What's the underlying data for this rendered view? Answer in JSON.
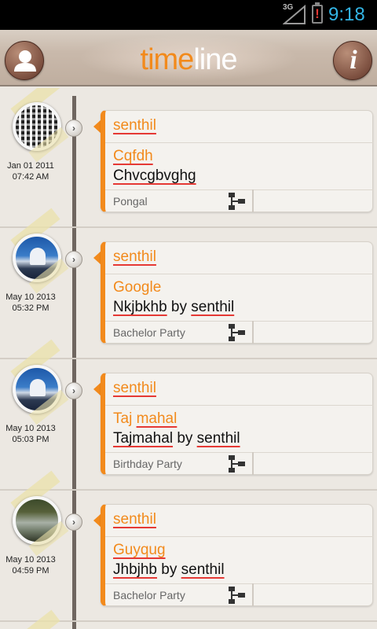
{
  "status_bar": {
    "network": "3G",
    "time": "9:18",
    "colors": {
      "time": "#33b5e5",
      "battery_alert": "#e53935"
    }
  },
  "header": {
    "logo_part1": "time",
    "logo_part2": "line",
    "left_icon": "profile-icon",
    "right_icon": "info-icon",
    "right_icon_glyph": "i",
    "colors": {
      "accent": "#f28a1c"
    }
  },
  "entries": [
    {
      "avatar": "qr-code-image",
      "date": "Jan 01 2011",
      "time": "07:42 AM",
      "user": "senthil",
      "title": "Cqfdh",
      "desc_main": "Chvcgbvghg",
      "desc_by": "",
      "desc_user": "",
      "event": "Pongal"
    },
    {
      "avatar": "taj-mahal-image",
      "date": "May 10 2013",
      "time": "05:32 PM",
      "user": "senthil",
      "title": "Google",
      "desc_main": "Nkjbkhb",
      "desc_by": " by ",
      "desc_user": "senthil",
      "event": "Bachelor Party"
    },
    {
      "avatar": "taj-mahal-image",
      "date": "May 10 2013",
      "time": "05:03 PM",
      "user": "senthil",
      "title_part1": "Taj",
      "title_part2": "mahal",
      "desc_main": "Tajmahal",
      "desc_by": " by ",
      "desc_user": "senthil",
      "event": "Birthday Party"
    },
    {
      "avatar": "forest-image",
      "date": "May 10 2013",
      "time": "04:59 PM",
      "user": "senthil",
      "title": "Guyqug",
      "desc_main": "Jhbjhb",
      "desc_by": " by ",
      "desc_user": "senthil",
      "event": "Bachelor Party"
    }
  ]
}
